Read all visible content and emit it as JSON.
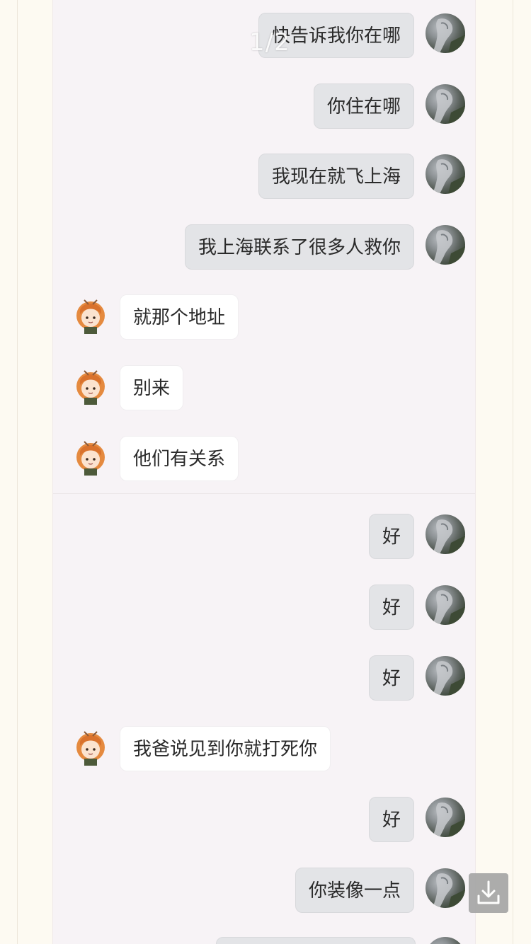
{
  "viewer": {
    "page_indicator": "1/2"
  },
  "messages": [
    {
      "sender": "me",
      "text": "快告诉我你在哪"
    },
    {
      "sender": "me",
      "text": "你住在哪"
    },
    {
      "sender": "me",
      "text": "我现在就飞上海"
    },
    {
      "sender": "me",
      "text": "我上海联系了很多人救你"
    },
    {
      "sender": "them",
      "text": "就那个地址"
    },
    {
      "sender": "them",
      "text": "别来"
    },
    {
      "sender": "them",
      "text": "他们有关系"
    },
    {
      "sender": "me",
      "text": "好"
    },
    {
      "sender": "me",
      "text": "好"
    },
    {
      "sender": "me",
      "text": "好"
    },
    {
      "sender": "them",
      "text": "我爸说见到你就打死你"
    },
    {
      "sender": "me",
      "text": "好"
    },
    {
      "sender": "me",
      "text": "你装像一点"
    }
  ],
  "icons": {
    "download": "download-icon",
    "my_avatar": "horse-photo-avatar",
    "their_avatar": "anime-girl-avatar"
  },
  "colors": {
    "page_background": "#fdfaf2",
    "chat_background": "#f7f3f6",
    "my_bubble": "#e3e4e7",
    "their_bubble": "#ffffff",
    "text": "#2a2a2a"
  }
}
